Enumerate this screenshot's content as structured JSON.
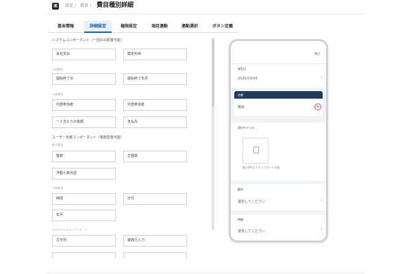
{
  "header": {
    "logo": "⌘",
    "breadcrumb": [
      "設定",
      "費目"
    ],
    "separator": "/",
    "title": "費目種別詳細"
  },
  "tabs": [
    {
      "label": "基本情報",
      "active": false
    },
    {
      "label": "詳細設定",
      "active": true
    },
    {
      "label": "権限設定",
      "active": false
    },
    {
      "label": "項目連動",
      "active": false
    },
    {
      "label": "連動選択",
      "active": false
    },
    {
      "label": "ボタン定義",
      "active": false
    }
  ],
  "left": {
    "system_section": "システムコンポーネント（一回のみ配置可能）",
    "date_group": "日時関連",
    "person_group": "人員関連",
    "user_section": "ユーザー定義コンポーネント（複数配置可能）",
    "number_group": "数字関連",
    "datetime_group": "日時関連",
    "custom_group": "カスタマイズコンポーネント",
    "items": {
      "company_payment": "会社支払",
      "account_item": "勘定科目",
      "start_end_date": "開始終了日",
      "start_end_month": "開始終了年月",
      "internal_participant": "内部参加者",
      "external_participant": "外部参加者",
      "per_person_amount": "一人当たりの金額",
      "payee": "支払先",
      "integer": "整数",
      "positive_integer": "正整数",
      "float": "浮動小数点型",
      "time": "時間",
      "date": "日付",
      "year_month": "年月",
      "string": "文字列",
      "multiline": "複数行入力"
    }
  },
  "phone": {
    "header_label": "費目",
    "occurrence_date_label": "発生日",
    "occurrence_date_value": "2025/09/04",
    "amount_label": "金額",
    "expense_value": "費目",
    "attachment_label": "添付ファイル",
    "upload_hint": "最大9件までアップロード可能",
    "city_label": "都市",
    "city_placeholder": "選択してください",
    "time_label": "時間",
    "time_placeholder": "選択してください",
    "chevron": "›",
    "plus": "+"
  },
  "colors": {
    "accent": "#1a5fa8",
    "tab_active_bg": "#e6f0fb",
    "phone_dark_header": "#233a5c",
    "plus_red": "#d14a6a"
  }
}
